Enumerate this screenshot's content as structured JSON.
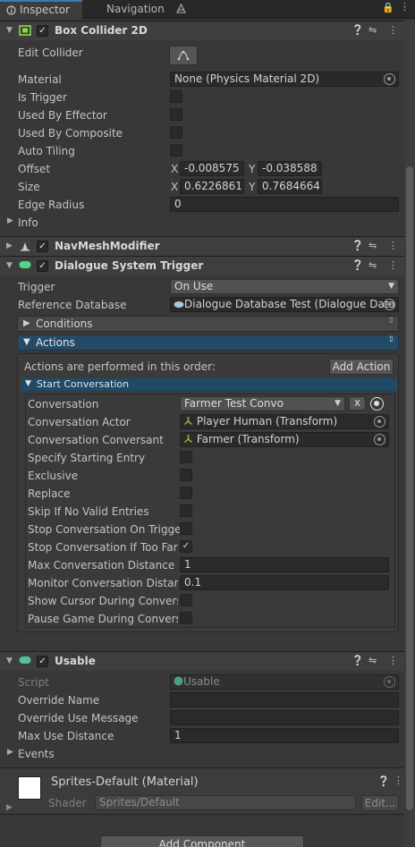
{
  "tabs": {
    "inspector": "Inspector",
    "navigation": "Navigation"
  },
  "box_collider": {
    "title": "Box Collider 2D",
    "edit_collider": "Edit Collider",
    "material_label": "Material",
    "material_value": "None (Physics Material 2D)",
    "is_trigger": "Is Trigger",
    "used_by_effector": "Used By Effector",
    "used_by_composite": "Used By Composite",
    "auto_tiling": "Auto Tiling",
    "offset_label": "Offset",
    "offset_x": "-0.008575",
    "offset_y": "-0.038588",
    "size_label": "Size",
    "size_x": "0.6226861",
    "size_y": "0.7684664",
    "edge_radius_label": "Edge Radius",
    "edge_radius_value": "0",
    "info": "Info",
    "x": "X",
    "y": "Y"
  },
  "navmesh": {
    "title": "NavMeshModifier"
  },
  "dialogue": {
    "title": "Dialogue System Trigger",
    "trigger_label": "Trigger",
    "trigger_value": "On Use",
    "refdb_label": "Reference Database",
    "refdb_value": "Dialogue Database Test (Dialogue Data",
    "conditions": "Conditions",
    "actions": "Actions",
    "actions_order": "Actions are performed in this order:",
    "add_action": "Add Action",
    "start_conversation": "Start Conversation",
    "conversation_label": "Conversation",
    "conversation_value": "Farmer Test Convo",
    "x_button": "x",
    "actor_label": "Conversation Actor",
    "actor_value": "Player Human (Transform)",
    "conversant_label": "Conversation Conversant",
    "conversant_value": "Farmer (Transform)",
    "specify_entry": "Specify Starting Entry",
    "exclusive": "Exclusive",
    "replace": "Replace",
    "skip_no_valid": "Skip If No Valid Entries",
    "stop_on_trigger": "Stop Conversation On Trigger",
    "stop_too_far": "Stop Conversation If Too Far",
    "max_distance_label": "Max Conversation Distance",
    "max_distance_value": "1",
    "monitor_distance_label": "Monitor Conversation Distanc",
    "monitor_distance_value": "0.1",
    "show_cursor": "Show Cursor During Conversa",
    "pause_game": "Pause Game During Conversa"
  },
  "usable": {
    "title": "Usable",
    "script_label": "Script",
    "script_value": "Usable",
    "override_name": "Override Name",
    "override_use_message": "Override Use Message",
    "max_use_distance_label": "Max Use Distance",
    "max_use_distance_value": "1",
    "events": "Events"
  },
  "material": {
    "title": "Sprites-Default (Material)",
    "shader_label": "Shader",
    "shader_value": "Sprites/Default",
    "edit_button": "Edit..."
  },
  "add_component": "Add Component",
  "colors": {
    "accent": "#3a79bb",
    "selected_header": "#244a66",
    "background": "#383838"
  }
}
